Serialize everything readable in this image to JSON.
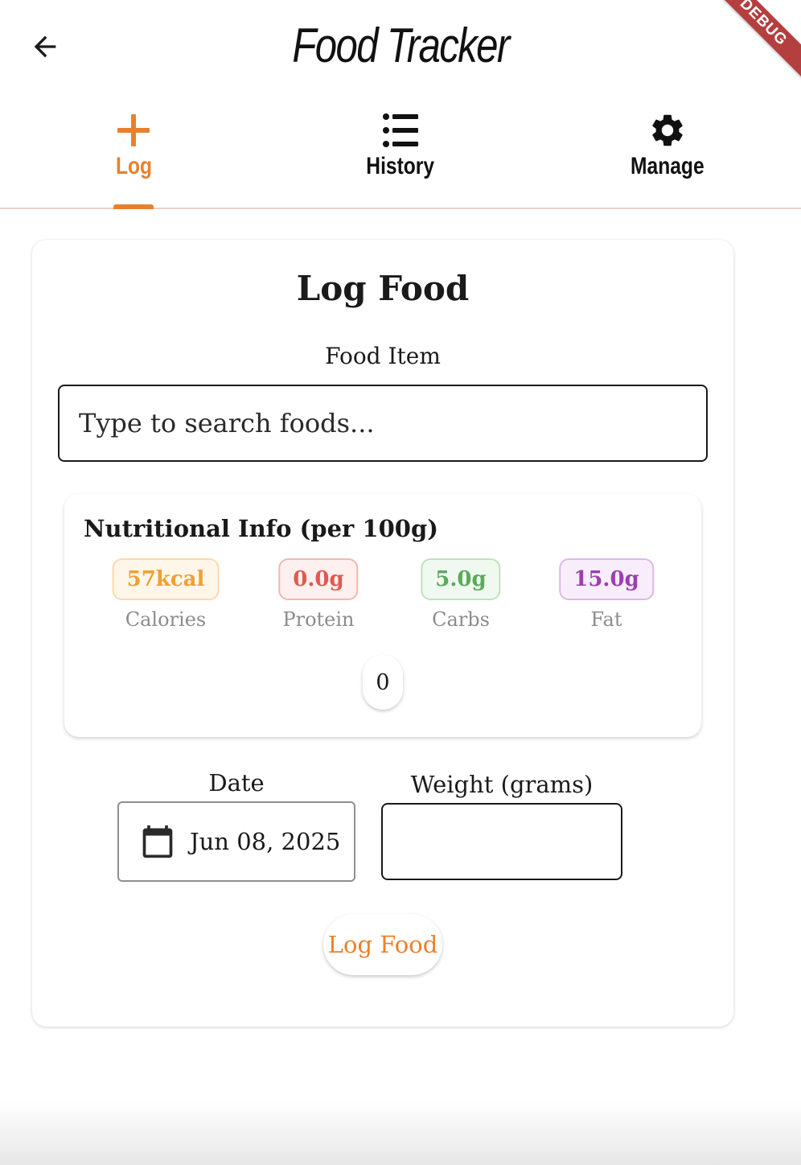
{
  "app_bar": {
    "title": "Food Tracker",
    "back_icon": "arrow-back-icon",
    "debug_banner": "DEBUG"
  },
  "tabs": [
    {
      "label": "Log",
      "icon": "plus-icon",
      "active": true
    },
    {
      "label": "History",
      "icon": "list-icon",
      "active": false
    },
    {
      "label": "Manage",
      "icon": "gear-icon",
      "active": false
    }
  ],
  "form": {
    "title": "Log Food",
    "food_item_label": "Food Item",
    "search_placeholder": "Type to search foods...",
    "search_value": "",
    "nutrition": {
      "title": "Nutritional Info (per 100g)",
      "macros": [
        {
          "value": "57kcal",
          "label": "Calories",
          "color": "#f0a02e"
        },
        {
          "value": "0.0g",
          "label": "Protein",
          "color": "#e05a4e"
        },
        {
          "value": "5.0g",
          "label": "Carbs",
          "color": "#5aaa5a"
        },
        {
          "value": "15.0g",
          "label": "Fat",
          "color": "#9c3fb0"
        }
      ],
      "count_chip": "0"
    },
    "date_label": "Date",
    "date_value": "Jun 08, 2025",
    "weight_label": "Weight (grams)",
    "weight_value": "",
    "submit_label": "Log Food"
  },
  "colors": {
    "accent": "#e8812e",
    "tab_divider": "#e6d3cc"
  }
}
